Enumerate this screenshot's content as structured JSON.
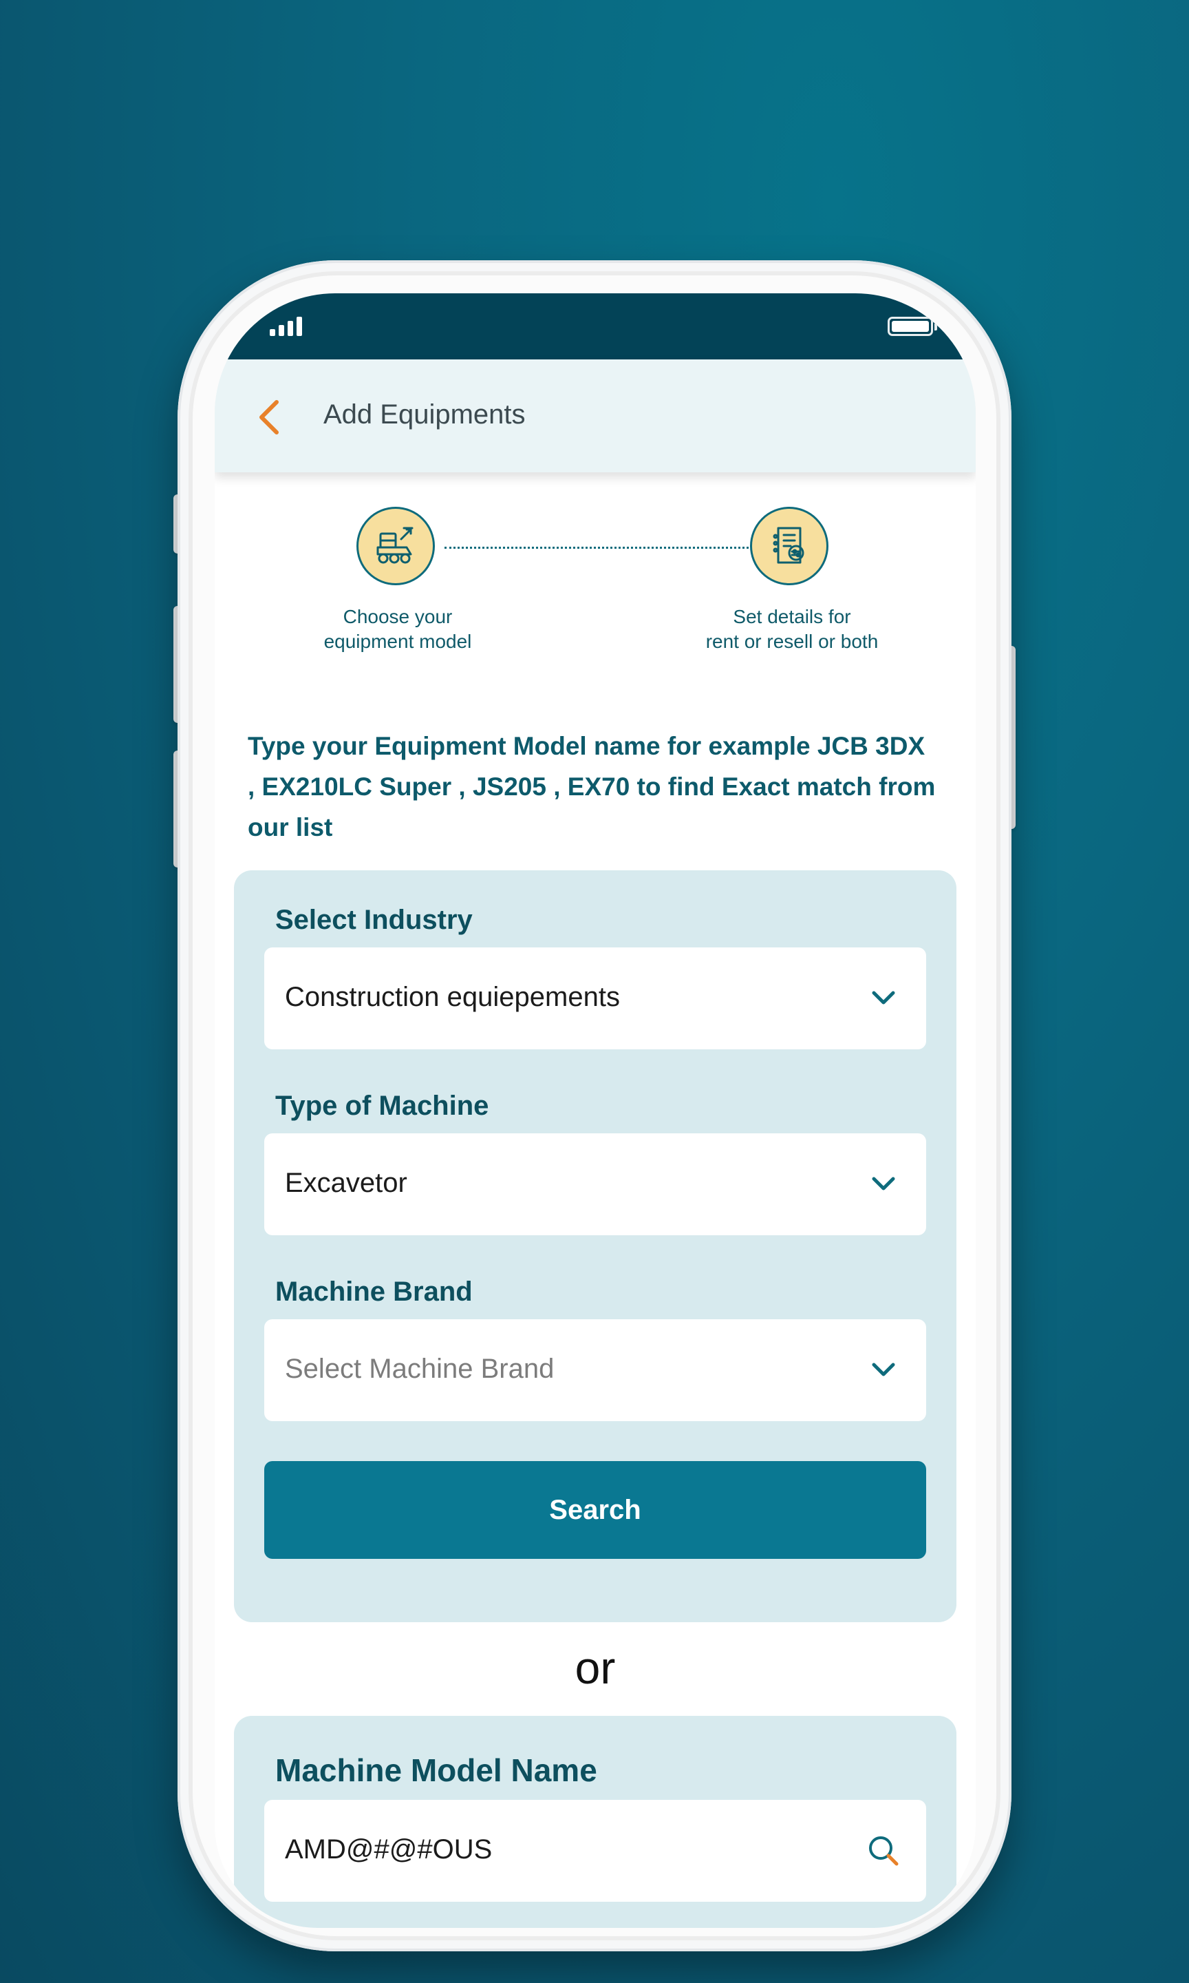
{
  "app": {
    "title": "Add Equipments"
  },
  "stepper": {
    "steps": [
      {
        "label": "Choose your\nequipment model",
        "icon": "loader-machine-icon"
      },
      {
        "label": "Set details for\nrent or resell or both",
        "icon": "document-settings-icon"
      }
    ]
  },
  "intro": {
    "text": "Type your Equipment Model name for example JCB 3DX , EX210LC Super , JS205 , EX70  to find Exact match from our list"
  },
  "form": {
    "industry": {
      "label": "Select Industry",
      "value": "Construction  equiepements"
    },
    "machine_type": {
      "label": "Type of Machine",
      "value": "Excavetor"
    },
    "brand": {
      "label": "Machine Brand",
      "placeholder": "Select Machine Brand"
    },
    "search_label": "Search"
  },
  "or_label": "or",
  "model_search": {
    "label": "Machine Model Name",
    "value": "AMD@#@#OUS"
  },
  "colors": {
    "background": "#0a6780",
    "status_bar": "#034357",
    "app_bar": "#eaf4f6",
    "accent": "#e8812a",
    "primary": "#0a7892",
    "card": "#d7eaee",
    "step_circle": "#f7df9e"
  }
}
